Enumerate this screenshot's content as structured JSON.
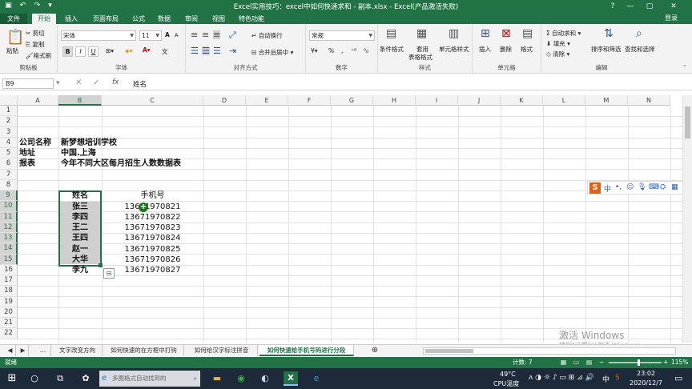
{
  "titlebar": {
    "title": "Excel实用技巧：excel中如何快速求和 - 副本.xlsx - Excel(产品激活失败)",
    "help": "?",
    "minimize": "—",
    "restore": "▢",
    "close": "✕"
  },
  "tabs": [
    "文件",
    "开始",
    "插入",
    "页面布局",
    "公式",
    "数据",
    "审阅",
    "视图",
    "特色功能"
  ],
  "login": "登录",
  "ribbon": {
    "clipboard": {
      "paste": "粘贴",
      "cut": "剪切",
      "copy": "复制",
      "format_painter": "格式刷",
      "label": "剪贴板"
    },
    "font": {
      "name": "宋体",
      "size": "11",
      "bold": "B",
      "italic": "I",
      "underline": "U",
      "grow": "A",
      "shrink": "A",
      "wen": "文",
      "label": "字体"
    },
    "alignment": {
      "wrap": "自动换行",
      "merge": "合并后居中",
      "label": "对齐方式"
    },
    "number": {
      "format": "常规",
      "percent": "%",
      "comma": ",",
      "label": "数字"
    },
    "styles": {
      "cond": "条件格式",
      "table1": "套用",
      "table2": "表格格式",
      "cellstyle": "单元格样式",
      "label": "样式"
    },
    "cells": {
      "insert": "插入",
      "delete": "删除",
      "format": "格式",
      "label": "单元格"
    },
    "editing": {
      "autosum": "自动求和",
      "fill": "填充",
      "clear": "清除",
      "sort": "排序和筛选",
      "find": "查找和选择",
      "label": "编辑"
    }
  },
  "formula_bar": {
    "name_box": "B9",
    "fx": "fx",
    "value": "姓名"
  },
  "columns": [
    "A",
    "B",
    "C",
    "D",
    "E",
    "F",
    "G",
    "H",
    "I",
    "J",
    "K",
    "L",
    "M",
    "N"
  ],
  "rows": [
    "1",
    "2",
    "3",
    "4",
    "5",
    "6",
    "7",
    "8",
    "9",
    "10",
    "11",
    "12",
    "13",
    "14",
    "15",
    "16",
    "17",
    "18",
    "19",
    "20",
    "21",
    "22"
  ],
  "cells": {
    "a4": "公司名称",
    "b4": "新梦想培训学校",
    "a5": "地址",
    "b5": "中国.上海",
    "a6": "报表",
    "b6": "今年不同大区每月招生人数数据表",
    "b9": "姓名",
    "c9": "手机号",
    "names": [
      "张三",
      "李四",
      "王二",
      "王四",
      "赵一",
      "大华",
      "李九"
    ],
    "phones": [
      "13671970821",
      "13671970822",
      "13671970823",
      "13671970824",
      "13671970825",
      "13671970826",
      "13671970827"
    ]
  },
  "sheet_tabs": [
    "...",
    "文字改变方向",
    "如何快速的在方框中打钩",
    "如何给汉字标注拼音",
    "如何快速给手机号码进行分段"
  ],
  "status": {
    "ready": "就绪",
    "count": "计数: 7",
    "zoom": "115%"
  },
  "watermark": {
    "line1": "激活 Windows",
    "line2": "转到\"设置\"以激活 Windows。"
  },
  "taskbar": {
    "search_placeholder": "多图格式自动找到的",
    "weather": "49°C",
    "cpu": "CPU温度",
    "time": "23:02",
    "date": "2020/12/7",
    "ime_lang": "中"
  },
  "colors": {
    "excel_green": "#217346",
    "taskbar": "#1c2a3a"
  }
}
